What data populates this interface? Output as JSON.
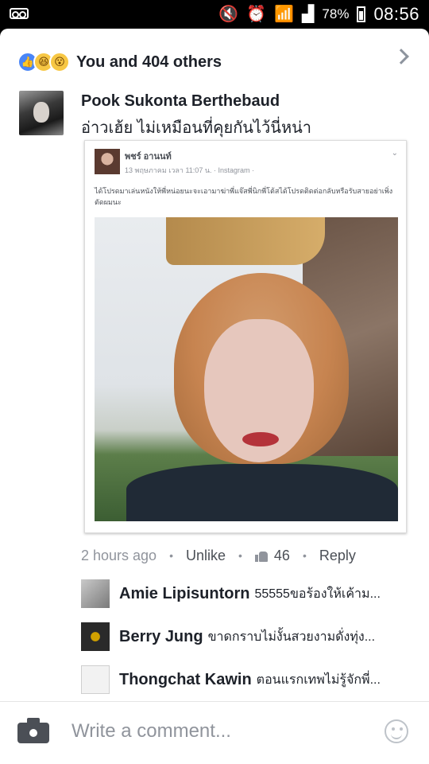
{
  "status_bar": {
    "mute_icon": "mute-icon",
    "alarm_icon": "alarm-icon",
    "wifi_icon": "wifi-icon",
    "signal_icon": "signal-icon",
    "battery_percent": "78%",
    "time": "08:56"
  },
  "reactions": {
    "icons": [
      "like-icon",
      "haha-icon",
      "wow-icon"
    ],
    "summary": "You and 404 others"
  },
  "comment": {
    "author": "Pook Sukonta Berthebaud",
    "text": "อ่าวเฮ้ย ไม่เหมือนที่คุยกันไว้นี่หน่า",
    "embed": {
      "author": "พชร์ อานนท์",
      "meta": "13 พฤษภาคม เวลา 11:07 น. · Instagram · ",
      "caption": "ได้โปรดมาเล่นหนังให้พี่หน่อยนะจะเอามาฆ่าพี่แจ๊สพี่นิกพี่โต้สได้โปรดติดต่อกลับหรือรับสายอย่าเพิ่งตัดผมนะ"
    },
    "time_ago": "2 hours ago",
    "unlike_label": "Unlike",
    "like_count": "46",
    "reply_label": "Reply"
  },
  "replies": [
    {
      "name": "Amie Lipisuntorn",
      "text": "55555ขอร้องให้เค้าม..."
    },
    {
      "name": "Berry Jung",
      "text": "ขาดกราบไม่งั้นสวยงามดั่งทุ่ง..."
    },
    {
      "name": "Thongchat Kawin",
      "text": "ตอนแรกเทพไม่รู้จักพี่..."
    }
  ],
  "composer": {
    "placeholder": "Write a comment..."
  },
  "colors": {
    "link_blue": "#4a86f7",
    "text_dark": "#1d2129",
    "text_muted": "#90949c"
  }
}
